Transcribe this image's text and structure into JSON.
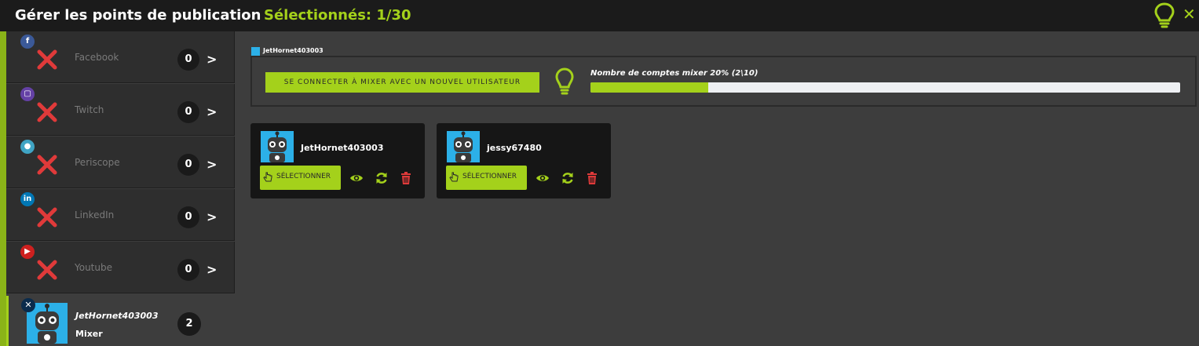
{
  "header": {
    "title": "Gérer les points de publication",
    "selected": "Sélectionnés: 1/30"
  },
  "sidebar": {
    "items": [
      {
        "network": "Facebook",
        "count": "0",
        "badge_icon": "facebook-icon",
        "badge_text": "f",
        "badge_color": "#3b5998"
      },
      {
        "network": "Twitch",
        "count": "0",
        "badge_icon": "twitch-icon",
        "badge_text": "▢",
        "badge_color": "#6441a5"
      },
      {
        "network": "Periscope",
        "count": "0",
        "badge_icon": "periscope-icon",
        "badge_text": "●",
        "badge_color": "#40a4c4"
      },
      {
        "network": "LinkedIn",
        "count": "0",
        "badge_icon": "linkedin-icon",
        "badge_text": "in",
        "badge_color": "#0077b5"
      },
      {
        "network": "Youtube",
        "count": "0",
        "badge_icon": "youtube-icon",
        "badge_text": "▶",
        "badge_color": "#cd201f"
      }
    ],
    "active": {
      "account": "JetHornet403003",
      "network": "Mixer",
      "count": "2",
      "badge_text": "✕"
    }
  },
  "main": {
    "section_tag": "JetHornet403003",
    "connect_button": "SE CONNECTER À MIXER AVEC UN NOUVEL UTILISATEUR",
    "quota_text": "Nombre de comptes mixer 20% (2\\10)",
    "quota_fraction": 0.2,
    "accounts": [
      {
        "name": "JetHornet403003",
        "select_label": "SÉLECTIONNER"
      },
      {
        "name": "jessy67480",
        "select_label": "SÉLECTIONNER"
      }
    ]
  },
  "colors": {
    "accent": "#a4d11b",
    "delete": "#e03a3a",
    "background": "#3d3d3d",
    "topbar": "#1b1b1b"
  }
}
